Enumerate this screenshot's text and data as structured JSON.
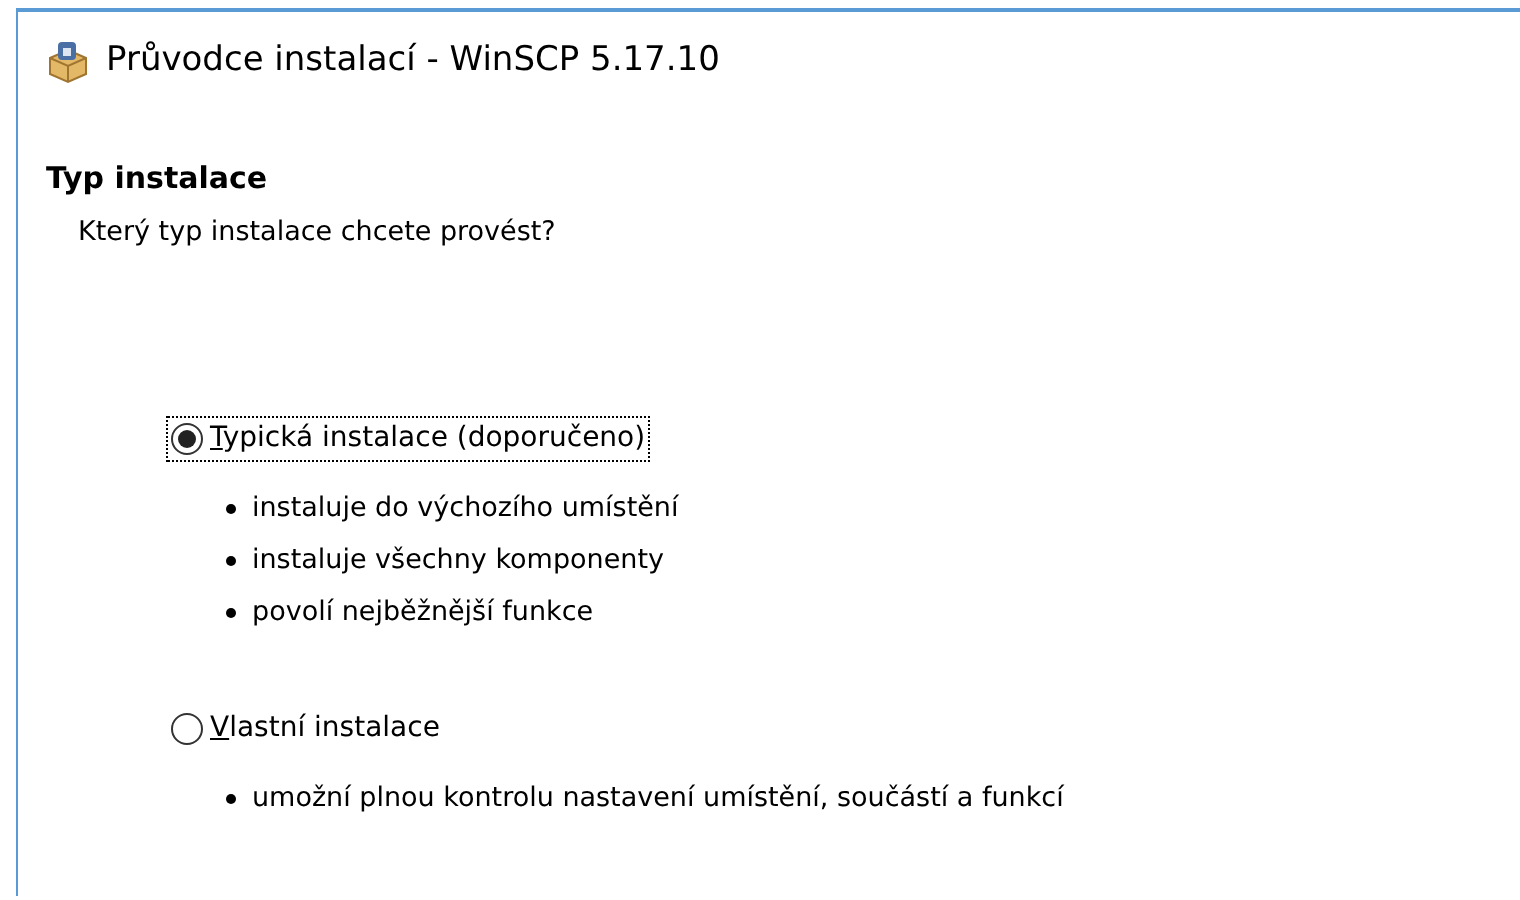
{
  "window": {
    "title": "Průvodce instalací - WinSCP 5.17.10"
  },
  "header": {
    "title": "Typ instalace",
    "subtitle": "Který typ instalace chcete provést?"
  },
  "options": [
    {
      "label": "Typická instalace (doporučeno)",
      "selected": true,
      "focused": true,
      "bullets": [
        "instaluje do výchozího umístění",
        "instaluje všechny komponenty",
        "povolí nejběžnější funkce"
      ]
    },
    {
      "label": "Vlastní instalace",
      "selected": false,
      "focused": false,
      "bullets": [
        "umožní plnou kontrolu nastavení umístění, součástí a funkcí"
      ]
    }
  ]
}
